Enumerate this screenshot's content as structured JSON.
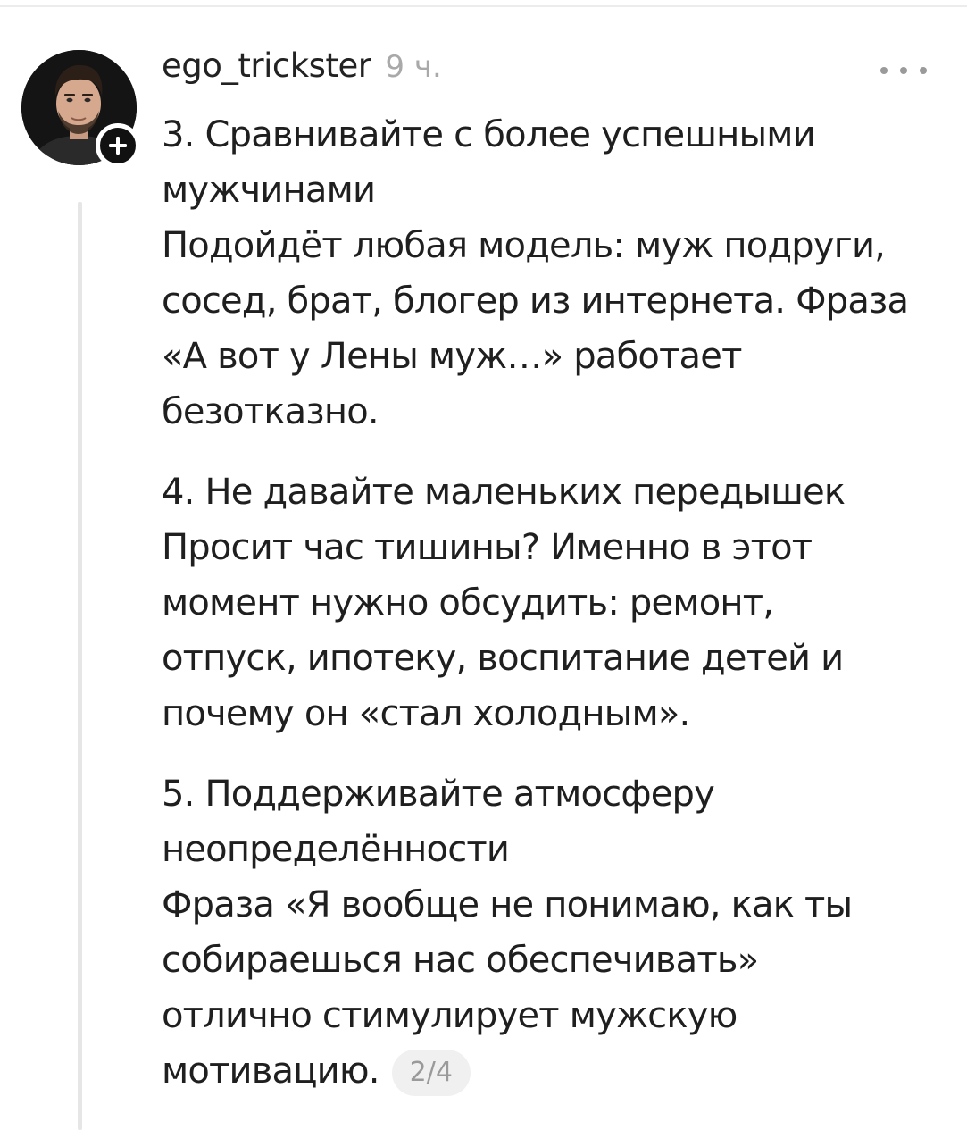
{
  "comment": {
    "author": {
      "username": "ego_trickster",
      "avatar_icon": "user-photo-avatar"
    },
    "timestamp": "9 ч.",
    "follow_icon": "plus-icon",
    "more_icon": "more-horizontal-icon",
    "paragraphs": [
      {
        "lines": [
          "3. Сравнивайте с более успешными",
          "мужчинами",
          "Подойдёт любая модель: муж подруги,",
          "сосед, брат, блогер из интернета. Фраза",
          "«А вот у Лены муж…» работает",
          "безотказно."
        ]
      },
      {
        "lines": [
          "4. Не давайте маленьких передышек",
          "Просит час тишины? Именно в этот",
          "момент нужно обсудить: ремонт,",
          "отпуск, ипотеку, воспитание детей и",
          "почему он «стал холодным»."
        ]
      },
      {
        "lines": [
          "5. Поддерживайте атмосферу",
          "неопределённости",
          "Фраза «Я вообще не понимаю, как ты",
          "собираешься нас обеспечивать»",
          "отлично стимулирует мужскую",
          "мотивацию."
        ]
      }
    ],
    "page_indicator": "2/4"
  },
  "colors": {
    "text": "#1f1f1f",
    "muted": "#a9a9a9",
    "thread_line": "#e6e6e6",
    "badge_bg": "#111111",
    "pill_bg": "#f0f0f0"
  }
}
